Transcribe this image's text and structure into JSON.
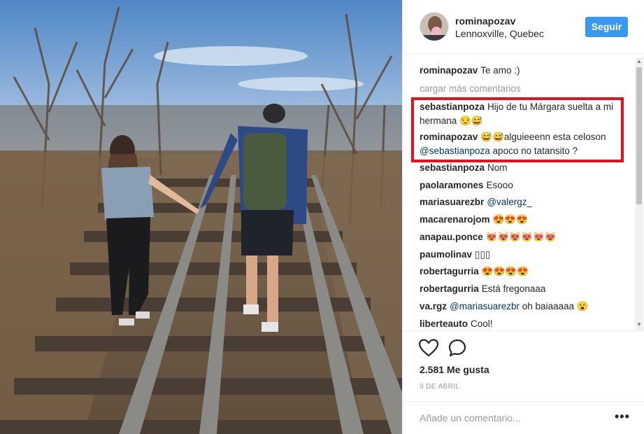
{
  "post": {
    "username": "rominapozav",
    "location": "Lennoxville, Quebec",
    "follow_label": "Seguir"
  },
  "comments": {
    "load_more": "cargar más comentarios",
    "items": [
      {
        "user": "rominapozav",
        "text": "Te amo :)"
      },
      {
        "user": "sebastianpoza",
        "text": "Hijo de tu Márgara suelta a mi hermana 😒😅"
      },
      {
        "user": "rominapozav",
        "text": "😅😅alguieeenn esta celoson",
        "mention": "@sebastianpoza",
        "after": "apoco no tatansito ?"
      },
      {
        "user": "sebastianpoza",
        "text": "Nom"
      },
      {
        "user": "paolaramones",
        "text": "Esooo"
      },
      {
        "user": "mariasuarezbr",
        "mention": "@valergz_"
      },
      {
        "user": "macarenarojom",
        "text": "😍😍😍"
      },
      {
        "user": "anapau.ponce",
        "text": "😻😻😻😻😻😻"
      },
      {
        "user": "paumolinav",
        "text": "▯▯▯"
      },
      {
        "user": "robertagurria",
        "text": "😍😍😍😍"
      },
      {
        "user": "robertagurria",
        "text": "Está fregonaaa"
      },
      {
        "user": "va.rgz",
        "mention": "@mariasuarezbr",
        "after": "oh baiaaaaa 😮"
      },
      {
        "user": "liberteauto",
        "text": "Cool!"
      }
    ]
  },
  "actions": {
    "likes": "2.581 Me gusta",
    "date": "9 DE ABRIL",
    "add_placeholder": "Añade un comentario...",
    "more": "•••"
  },
  "colors": {
    "follow_blue": "#3897f0",
    "highlight_red": "#e8101a",
    "mention_blue": "#003569"
  }
}
